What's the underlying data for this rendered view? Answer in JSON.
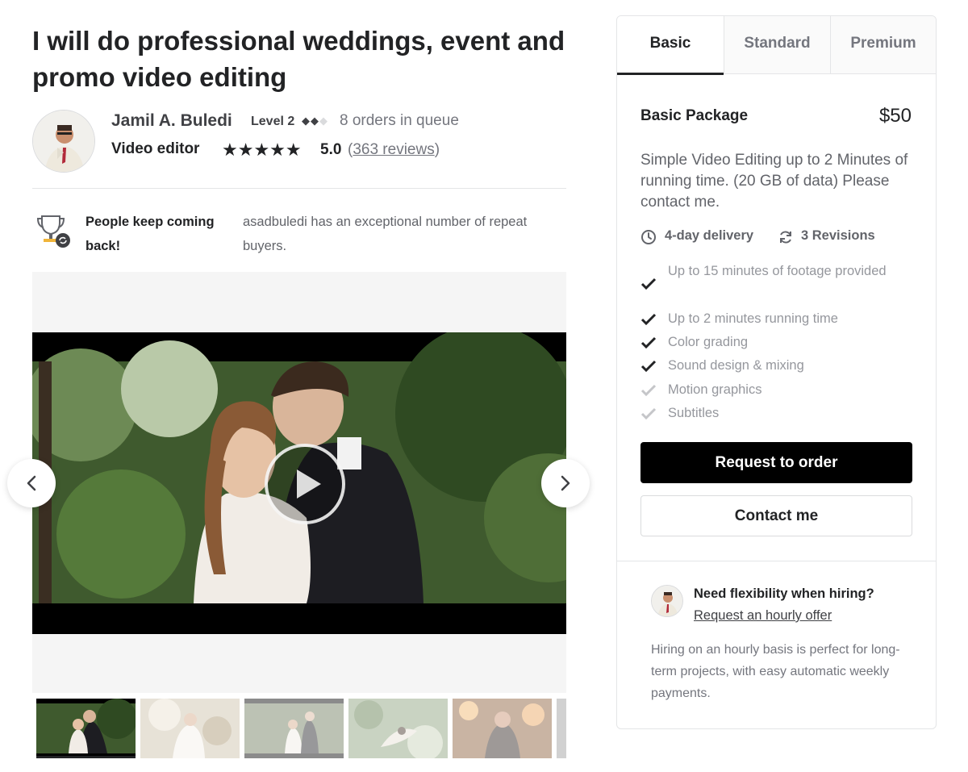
{
  "gig": {
    "title": "I will do professional weddings, event and promo video editing"
  },
  "seller": {
    "name": "Jamil A. Buledi",
    "level": "Level 2",
    "queue": "8 orders in queue",
    "role": "Video editor",
    "stars": "★★★★★",
    "rating": "5.0",
    "reviews_open": "(",
    "reviews_link": "363 reviews",
    "reviews_close": ")"
  },
  "highlight": {
    "icon": "trophy-icon",
    "title": "People keep coming back!",
    "text": "asadbuledi has an exceptional number of repeat buyers."
  },
  "media": {
    "prev_icon": "chevron-left-icon",
    "next_icon": "chevron-right-icon",
    "play_icon": "play-icon"
  },
  "packages": {
    "tabs": [
      "Basic",
      "Standard",
      "Premium"
    ],
    "active_tab": "Basic",
    "name": "Basic Package",
    "price": "$50",
    "description": "Simple Video Editing up to 2 Minutes of running time. (20 GB of data) Please contact me.",
    "delivery": "4-day delivery",
    "revisions": "3 Revisions",
    "features": [
      {
        "text": "Up to 15 minutes of footage provided",
        "included": true
      },
      {
        "text": "Up to 2 minutes running time",
        "included": true
      },
      {
        "text": "Color grading",
        "included": true
      },
      {
        "text": "Sound design & mixing",
        "included": true
      },
      {
        "text": "Motion graphics",
        "included": false
      },
      {
        "text": "Subtitles",
        "included": false
      }
    ],
    "order_button": "Request to order",
    "contact_button": "Contact me"
  },
  "flexibility": {
    "title": "Need flexibility when hiring?",
    "link": "Request an hourly offer",
    "description": "Hiring on an hourly basis is perfect for long-term projects, with easy automatic weekly payments."
  },
  "colors": {
    "text_primary": "#222325",
    "text_secondary": "#62646a",
    "text_muted": "#95979d",
    "check_on": "#222325",
    "check_off": "#c5c6c9",
    "button_primary": "#000000"
  }
}
